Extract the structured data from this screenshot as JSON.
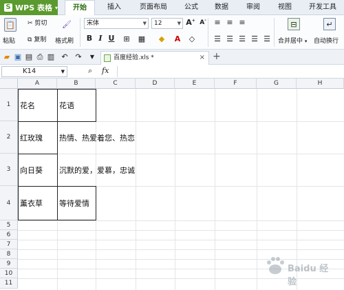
{
  "app": {
    "logo": "WPS 表格"
  },
  "menu": {
    "tabs": [
      {
        "label": "开始",
        "active": true
      },
      {
        "label": "插入"
      },
      {
        "label": "页面布局"
      },
      {
        "label": "公式"
      },
      {
        "label": "数据"
      },
      {
        "label": "审阅"
      },
      {
        "label": "视图"
      },
      {
        "label": "开发工具"
      }
    ]
  },
  "ribbon": {
    "paste": "粘贴",
    "cut": "剪切",
    "copy": "复制",
    "format_painter": "格式刷",
    "font_name": "宋体",
    "font_size": "12",
    "bold": "B",
    "italic": "I",
    "underline": "U",
    "merge_center": "合并居中",
    "auto_wrap": "自动换行"
  },
  "tabbar": {
    "doc_name": "百度经验.xls *",
    "close": "×",
    "add": "+"
  },
  "formula_bar": {
    "cell_ref": "K14",
    "fx": "fx",
    "value": ""
  },
  "sheet": {
    "columns": [
      "A",
      "B",
      "C",
      "D",
      "E",
      "F",
      "G",
      "H"
    ],
    "rows": [
      {
        "num": "1",
        "a": "花名",
        "b": "花语"
      },
      {
        "num": "2",
        "a": "红玫瑰",
        "b": "热情、热爱着您、热恋"
      },
      {
        "num": "3",
        "a": "向日葵",
        "b": "沉默的爱，爱慕，忠诚"
      },
      {
        "num": "4",
        "a": "薰衣草",
        "b": "等待爱情"
      },
      {
        "num": "5"
      },
      {
        "num": "6"
      },
      {
        "num": "7"
      },
      {
        "num": "8"
      },
      {
        "num": "9"
      },
      {
        "num": "10"
      },
      {
        "num": "11"
      }
    ]
  },
  "watermark": {
    "text": "Baidu 经验"
  }
}
